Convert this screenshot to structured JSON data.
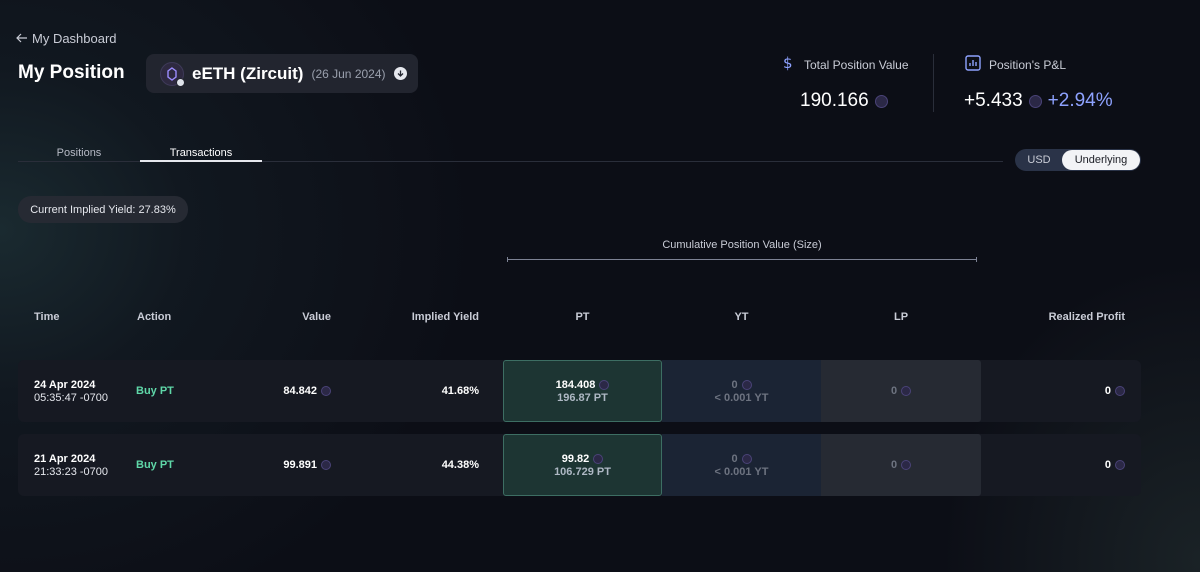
{
  "nav": {
    "back_label": "My Dashboard"
  },
  "header": {
    "title": "My Position",
    "market": {
      "name": "eETH (Zircuit)",
      "date": "(26 Jun 2024)"
    }
  },
  "stats": {
    "total_label": "Total Position Value",
    "total_value": "190.166",
    "pnl_label": "Position's P&L",
    "pnl_value": "+5.433",
    "pnl_pct": "+2.94%"
  },
  "tabs": [
    {
      "label": "Positions",
      "active": false
    },
    {
      "label": "Transactions",
      "active": true
    }
  ],
  "toggle": {
    "options": [
      "USD",
      "Underlying"
    ],
    "selected": "Underlying"
  },
  "implied_yield_badge": "Current Implied Yield: 27.83%",
  "table": {
    "group_header": "Cumulative Position Value (Size)",
    "columns": [
      "Time",
      "Action",
      "Value",
      "Implied Yield",
      "PT",
      "YT",
      "LP",
      "Realized Profit"
    ],
    "rows": [
      {
        "date": "24 Apr 2024",
        "time": "05:35:47 -0700",
        "action": "Buy PT",
        "value": "84.842",
        "implied_yield": "41.68%",
        "pt_value": "184.408",
        "pt_size": "196.87 PT",
        "yt_value": "0",
        "yt_size": "< 0.001 YT",
        "lp_value": "0",
        "realized_profit": "0"
      },
      {
        "date": "21 Apr 2024",
        "time": "21:33:23 -0700",
        "action": "Buy PT",
        "value": "99.891",
        "implied_yield": "44.38%",
        "pt_value": "99.82",
        "pt_size": "106.729 PT",
        "yt_value": "0",
        "yt_size": "< 0.001 YT",
        "lp_value": "0",
        "realized_profit": "0"
      }
    ]
  },
  "colors": {
    "accent": "#8ea2ff",
    "buy": "#5fd7a8",
    "pt_bg": "#1d3533",
    "yt_bg": "#1b2434",
    "lp_bg": "#262a33"
  }
}
